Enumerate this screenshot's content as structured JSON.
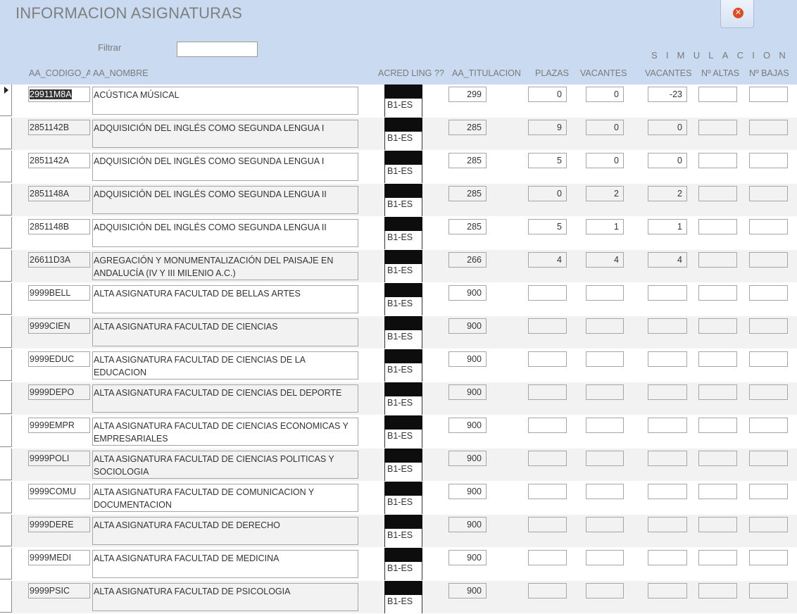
{
  "window": {
    "title": "INFORMACION ASIGNATURAS",
    "close_icon": "close-icon"
  },
  "filter": {
    "label": "Filtrar",
    "value": ""
  },
  "simulation_label": "SIMULACION",
  "columns": {
    "code": "AA_CODIGO_A",
    "name": "AA_NOMBRE",
    "acred": "ACRED LING ??",
    "titulacion": "AA_TITULACION",
    "plazas": "PLAZAS",
    "vacantes": "VACANTES",
    "sim_vacantes": "VACANTES",
    "altas": "Nº ALTAS",
    "bajas": "Nº BAJAS"
  },
  "rows": [
    {
      "code": "29911M8A",
      "name": "ACÚSTICA MÚSICAL",
      "acred": "B1-ES",
      "titulacion": "299",
      "plazas": "0",
      "vacantes": "0",
      "sim_vacantes": "-23",
      "altas": "",
      "bajas": ""
    },
    {
      "code": "2851142B",
      "name": "ADQUISICIÓN DEL INGLÉS COMO SEGUNDA LENGUA I",
      "acred": "B1-ES",
      "titulacion": "285",
      "plazas": "9",
      "vacantes": "0",
      "sim_vacantes": "0",
      "altas": "",
      "bajas": ""
    },
    {
      "code": "2851142A",
      "name": "ADQUISICIÓN DEL INGLÉS COMO SEGUNDA LENGUA I",
      "acred": "B1-ES",
      "titulacion": "285",
      "plazas": "5",
      "vacantes": "0",
      "sim_vacantes": "0",
      "altas": "",
      "bajas": ""
    },
    {
      "code": "2851148A",
      "name": "ADQUISICIÓN DEL INGLÉS COMO SEGUNDA LENGUA II",
      "acred": "B1-ES",
      "titulacion": "285",
      "plazas": "0",
      "vacantes": "2",
      "sim_vacantes": "2",
      "altas": "",
      "bajas": ""
    },
    {
      "code": "2851148B",
      "name": "ADQUISICIÓN DEL INGLÉS COMO SEGUNDA LENGUA II",
      "acred": "B1-ES",
      "titulacion": "285",
      "plazas": "5",
      "vacantes": "1",
      "sim_vacantes": "1",
      "altas": "",
      "bajas": ""
    },
    {
      "code": "26611D3A",
      "name": "AGREGACIÓN Y MONUMENTALIZACIÓN DEL PAISAJE EN ANDALUCÍA (IV Y III MILENIO A.C.)",
      "acred": "B1-ES",
      "titulacion": "266",
      "plazas": "4",
      "vacantes": "4",
      "sim_vacantes": "4",
      "altas": "",
      "bajas": ""
    },
    {
      "code": "9999BELL",
      "name": "ALTA ASIGNATURA FACULTAD DE BELLAS ARTES",
      "acred": "B1-ES",
      "titulacion": "900",
      "plazas": "",
      "vacantes": "",
      "sim_vacantes": "",
      "altas": "",
      "bajas": ""
    },
    {
      "code": "9999CIEN",
      "name": "ALTA ASIGNATURA FACULTAD DE CIENCIAS",
      "acred": "B1-ES",
      "titulacion": "900",
      "plazas": "",
      "vacantes": "",
      "sim_vacantes": "",
      "altas": "",
      "bajas": ""
    },
    {
      "code": "9999EDUC",
      "name": "ALTA ASIGNATURA FACULTAD DE CIENCIAS DE LA EDUCACION",
      "acred": "B1-ES",
      "titulacion": "900",
      "plazas": "",
      "vacantes": "",
      "sim_vacantes": "",
      "altas": "",
      "bajas": ""
    },
    {
      "code": "9999DEPO",
      "name": "ALTA ASIGNATURA FACULTAD DE CIENCIAS DEL DEPORTE",
      "acred": "B1-ES",
      "titulacion": "900",
      "plazas": "",
      "vacantes": "",
      "sim_vacantes": "",
      "altas": "",
      "bajas": ""
    },
    {
      "code": "9999EMPR",
      "name": "ALTA ASIGNATURA FACULTAD DE CIENCIAS ECONOMICAS Y EMPRESARIALES",
      "acred": "B1-ES",
      "titulacion": "900",
      "plazas": "",
      "vacantes": "",
      "sim_vacantes": "",
      "altas": "",
      "bajas": ""
    },
    {
      "code": "9999POLI",
      "name": "ALTA ASIGNATURA FACULTAD DE CIENCIAS POLITICAS Y SOCIOLOGIA",
      "acred": "B1-ES",
      "titulacion": "900",
      "plazas": "",
      "vacantes": "",
      "sim_vacantes": "",
      "altas": "",
      "bajas": ""
    },
    {
      "code": "9999COMU",
      "name": "ALTA ASIGNATURA FACULTAD DE COMUNICACION Y DOCUMENTACION",
      "acred": "B1-ES",
      "titulacion": "900",
      "plazas": "",
      "vacantes": "",
      "sim_vacantes": "",
      "altas": "",
      "bajas": ""
    },
    {
      "code": "9999DERE",
      "name": "ALTA ASIGNATURA FACULTAD DE DERECHO",
      "acred": "B1-ES",
      "titulacion": "900",
      "plazas": "",
      "vacantes": "",
      "sim_vacantes": "",
      "altas": "",
      "bajas": ""
    },
    {
      "code": "9999MEDI",
      "name": "ALTA ASIGNATURA FACULTAD DE MEDICINA",
      "acred": "B1-ES",
      "titulacion": "900",
      "plazas": "",
      "vacantes": "",
      "sim_vacantes": "",
      "altas": "",
      "bajas": ""
    },
    {
      "code": "9999PSIC",
      "name": "ALTA ASIGNATURA FACULTAD DE PSICOLOGIA",
      "acred": "B1-ES",
      "titulacion": "900",
      "plazas": "",
      "vacantes": "",
      "sim_vacantes": "",
      "altas": "",
      "bajas": ""
    }
  ]
}
